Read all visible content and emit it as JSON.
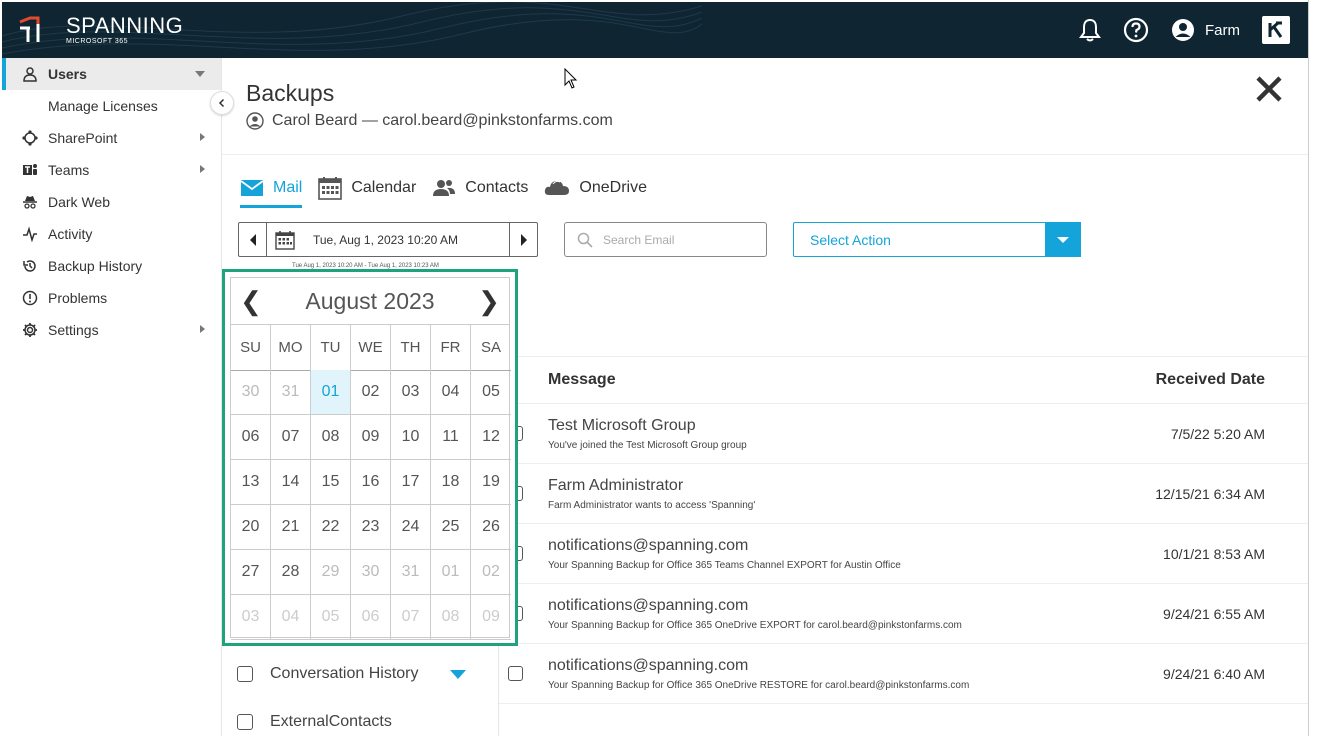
{
  "app": {
    "brand": "SPANNING",
    "brand_sub": "MICROSOFT 365",
    "user_name": "Farm",
    "kaseya_letter": "K",
    "accent_color": "#14a4d9",
    "header_bg": "#0f2532",
    "highlight_color": "#1fa37f"
  },
  "sidebar": {
    "items": [
      {
        "label": "Users",
        "icon": "user-icon"
      },
      {
        "label": "Manage Licenses",
        "icon": ""
      },
      {
        "label": "SharePoint",
        "icon": "sharepoint-icon"
      },
      {
        "label": "Teams",
        "icon": "teams-icon"
      },
      {
        "label": "Dark Web",
        "icon": "spy-icon"
      },
      {
        "label": "Activity",
        "icon": "pulse-icon"
      },
      {
        "label": "Backup History",
        "icon": "history-icon"
      },
      {
        "label": "Problems",
        "icon": "alert-circle-icon"
      },
      {
        "label": "Settings",
        "icon": "gear-icon"
      }
    ]
  },
  "page": {
    "title": "Backups",
    "user_line": "Carol Beard — carol.beard@pinkstonfarms.com"
  },
  "tabs": [
    {
      "label": "Mail",
      "icon": "envelope-icon",
      "active": true
    },
    {
      "label": "Calendar",
      "icon": "calendar-icon",
      "active": false
    },
    {
      "label": "Contacts",
      "icon": "people-icon",
      "active": false
    },
    {
      "label": "OneDrive",
      "icon": "cloud-icon",
      "active": false
    }
  ],
  "toolbar": {
    "date_value": "Tue, Aug 1, 2023 10:20 AM",
    "date_range": "Tue Aug 1, 2023 10:20 AM - Tue Aug 1, 2023 10:23 AM",
    "search_placeholder": "Search Email",
    "select_action": "Select Action"
  },
  "table": {
    "col_message": "Message",
    "col_received": "Received Date",
    "rows": [
      {
        "from": "Test Microsoft Group",
        "subject": "You've joined the Test Microsoft Group group",
        "date": "7/5/22 5:20 AM"
      },
      {
        "from": "Farm Administrator",
        "subject": "Farm Administrator wants to access 'Spanning'",
        "date": "12/15/21 6:34 AM"
      },
      {
        "from": "notifications@spanning.com",
        "subject": "Your Spanning Backup for Office 365 Teams Channel EXPORT for Austin Office",
        "date": "10/1/21 8:53 AM"
      },
      {
        "from": "notifications@spanning.com",
        "subject": "Your Spanning Backup for Office 365 OneDrive EXPORT for carol.beard@pinkstonfarms.com",
        "date": "9/24/21 6:55 AM"
      },
      {
        "from": "notifications@spanning.com",
        "subject": "Your Spanning Backup for Office 365 OneDrive RESTORE for carol.beard@pinkstonfarms.com",
        "date": "9/24/21 6:40 AM"
      }
    ]
  },
  "folders": [
    {
      "label": "Conversation History"
    },
    {
      "label": "ExternalContacts"
    }
  ],
  "datepicker": {
    "title": "August 2023",
    "prev": "❮",
    "next": "❯",
    "weekdays": [
      "SU",
      "MO",
      "TU",
      "WE",
      "TH",
      "FR",
      "SA"
    ],
    "weeks": [
      [
        "30",
        "31",
        "01",
        "02",
        "03",
        "04",
        "05"
      ],
      [
        "06",
        "07",
        "08",
        "09",
        "10",
        "11",
        "12"
      ],
      [
        "13",
        "14",
        "15",
        "16",
        "17",
        "18",
        "19"
      ],
      [
        "20",
        "21",
        "22",
        "23",
        "24",
        "25",
        "26"
      ],
      [
        "27",
        "28",
        "29",
        "30",
        "31",
        "01",
        "02"
      ],
      [
        "03",
        "04",
        "05",
        "06",
        "07",
        "08",
        "09"
      ]
    ],
    "selected": "01"
  }
}
